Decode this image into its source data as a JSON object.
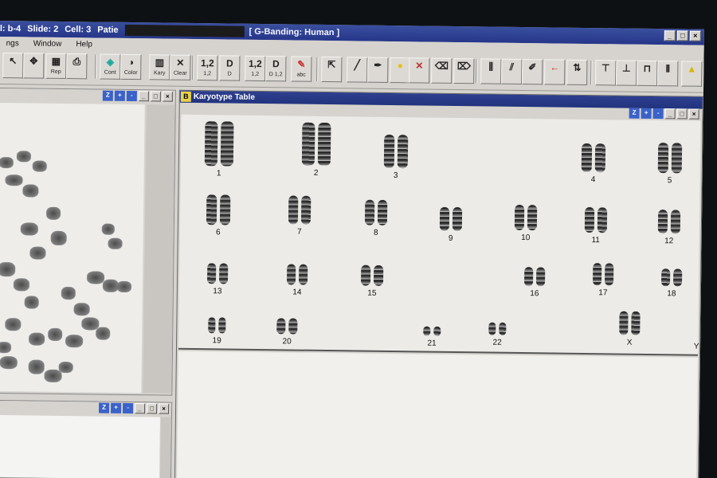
{
  "title_bar": {
    "segments": [
      "l: b-4",
      "Slide: 2",
      "Cell: 3",
      "Patie"
    ],
    "mode": "[ G-Banding: Human ]"
  },
  "menu": [
    "ngs",
    "Window",
    "Help"
  ],
  "toolbar": [
    {
      "icon": "cursor-arrow-icon",
      "label": ""
    },
    {
      "icon": "move-icon",
      "label": ""
    },
    {
      "icon": "rep-icon",
      "label": "Rep"
    },
    {
      "icon": "printer-icon",
      "label": ""
    },
    {
      "icon": "cont-icon",
      "label": "Cont"
    },
    {
      "icon": "color-icon",
      "label": "Color"
    },
    {
      "icon": "kary-icon",
      "label": "Kary"
    },
    {
      "icon": "clear-icon",
      "label": "Clear"
    },
    {
      "icon": "one-two-icon",
      "label": "1,2"
    },
    {
      "icon": "d-icon",
      "label": "D"
    },
    {
      "icon": "one-two-icon",
      "label": "1,2"
    },
    {
      "icon": "d-one-two-icon",
      "label": "D 1,2"
    },
    {
      "icon": "abc-icon",
      "label": "abc"
    },
    {
      "icon": "pointer-icon",
      "label": ""
    },
    {
      "icon": "brush-icon",
      "label": ""
    },
    {
      "icon": "pen-icon",
      "label": ""
    },
    {
      "icon": "dot-icon",
      "label": ""
    },
    {
      "icon": "cross-icon",
      "label": ""
    },
    {
      "icon": "erase-icon",
      "label": ""
    },
    {
      "icon": "erase2-icon",
      "label": ""
    },
    {
      "icon": "chrom-tool-icon",
      "label": ""
    },
    {
      "icon": "chrom-tool2-icon",
      "label": ""
    },
    {
      "icon": "chrom-edit-icon",
      "label": ""
    },
    {
      "icon": "arrow-left-icon",
      "label": ""
    },
    {
      "icon": "flip-icon",
      "label": ""
    },
    {
      "icon": "align-top-icon",
      "label": ""
    },
    {
      "icon": "align-mid-icon",
      "label": ""
    },
    {
      "icon": "align-bottom-icon",
      "label": ""
    },
    {
      "icon": "split-icon",
      "label": ""
    },
    {
      "icon": "warning-icon",
      "label": ""
    },
    {
      "icon": "warning2-icon",
      "label": ""
    }
  ],
  "karyotype_window": {
    "badge": "B",
    "title": "Karyotype Table",
    "chromosomes": [
      {
        "label": "1"
      },
      {
        "label": "2"
      },
      {
        "label": "3"
      },
      {
        "label": "4"
      },
      {
        "label": "5"
      },
      {
        "label": "6"
      },
      {
        "label": "7"
      },
      {
        "label": "8"
      },
      {
        "label": "9"
      },
      {
        "label": "10"
      },
      {
        "label": "11"
      },
      {
        "label": "12"
      },
      {
        "label": "13"
      },
      {
        "label": "14"
      },
      {
        "label": "15"
      },
      {
        "label": "16"
      },
      {
        "label": "17"
      },
      {
        "label": "18"
      },
      {
        "label": "19"
      },
      {
        "label": "20"
      },
      {
        "label": "21"
      },
      {
        "label": "22"
      },
      {
        "label": "X"
      },
      {
        "label": "Y"
      }
    ]
  },
  "mini_window_buttons": [
    "Z",
    "+",
    "-"
  ]
}
